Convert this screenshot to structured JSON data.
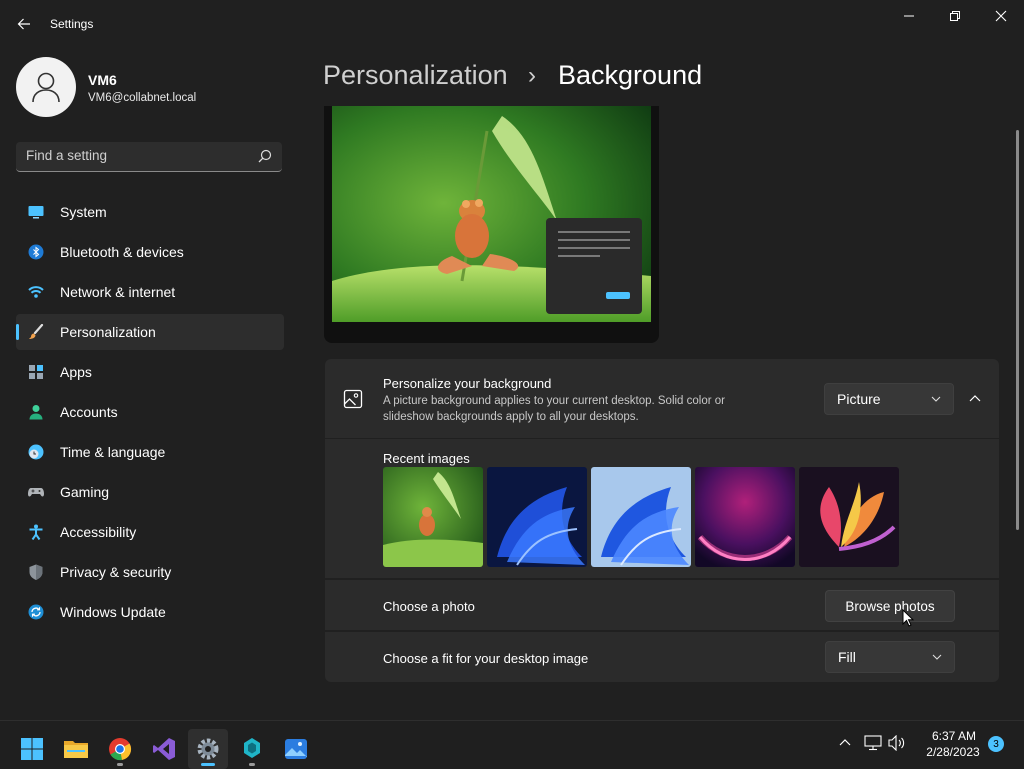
{
  "window": {
    "title": "Settings"
  },
  "profile": {
    "name": "VM6",
    "email": "VM6@collabnet.local"
  },
  "search": {
    "placeholder": "Find a setting"
  },
  "nav": {
    "items": [
      {
        "label": "System",
        "icon": "monitor-icon"
      },
      {
        "label": "Bluetooth & devices",
        "icon": "bluetooth-icon"
      },
      {
        "label": "Network & internet",
        "icon": "wifi-icon"
      },
      {
        "label": "Personalization",
        "icon": "brush-icon",
        "active": true
      },
      {
        "label": "Apps",
        "icon": "apps-icon"
      },
      {
        "label": "Accounts",
        "icon": "person-icon"
      },
      {
        "label": "Time & language",
        "icon": "clock-globe-icon"
      },
      {
        "label": "Gaming",
        "icon": "gamepad-icon"
      },
      {
        "label": "Accessibility",
        "icon": "accessibility-icon"
      },
      {
        "label": "Privacy & security",
        "icon": "shield-icon"
      },
      {
        "label": "Windows Update",
        "icon": "update-icon"
      }
    ]
  },
  "header": {
    "parent": "Personalization",
    "separator": "›",
    "current": "Background"
  },
  "background": {
    "title": "Personalize your background",
    "description_line1": "A picture background applies to your current desktop. Solid color or",
    "description_line2": "slideshow backgrounds apply to all your desktops.",
    "type_value": "Picture",
    "recent_label": "Recent images",
    "choose_photo_label": "Choose a photo",
    "browse_button": "Browse photos",
    "fit_label": "Choose a fit for your desktop image",
    "fit_value": "Fill"
  },
  "taskbar": {
    "time": "6:37 AM",
    "date": "2/28/2023",
    "notification_count": "3",
    "apps": [
      "start-icon",
      "file-explorer-icon",
      "chrome-icon",
      "visual-studio-icon",
      "settings-icon",
      "app-icon",
      "photos-icon"
    ]
  },
  "colors": {
    "accent": "#4cc2ff",
    "background": "#202020",
    "card": "#2b2b2b"
  }
}
